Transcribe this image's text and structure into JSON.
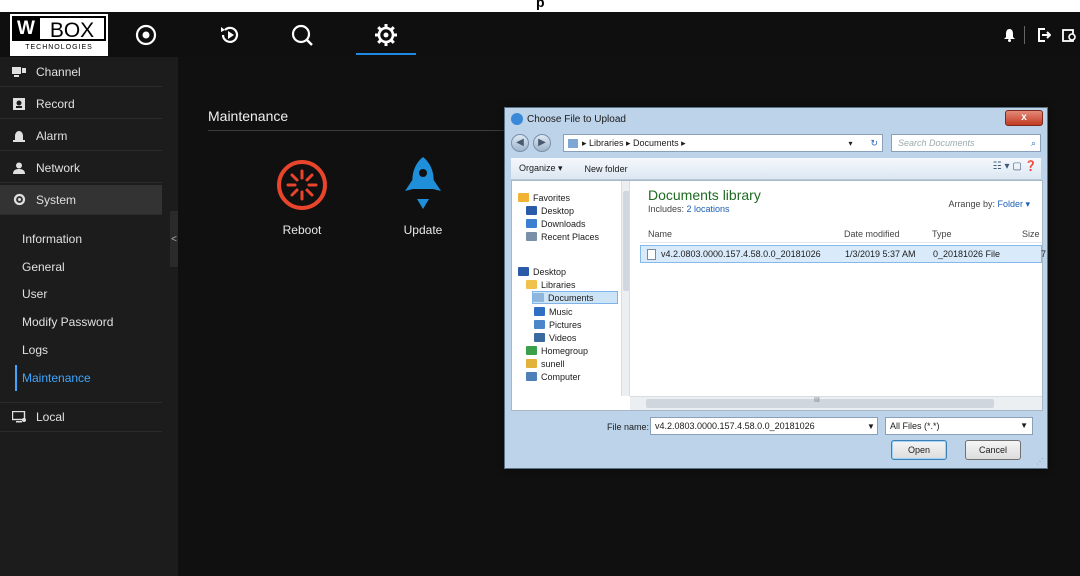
{
  "top_banner": "p",
  "brand": {
    "logo_main_left": "W",
    "logo_main_right": "BOX",
    "logo_sub": "TECHNOLOGIES"
  },
  "top_nav": [
    "live-view-icon",
    "playback-icon",
    "search-icon",
    "settings-icon"
  ],
  "top_right": [
    "bell-icon",
    "logout-icon",
    "lock-icon"
  ],
  "sidebar": {
    "items": [
      {
        "label": "Channel",
        "icon": "channel-icon"
      },
      {
        "label": "Record",
        "icon": "record-icon"
      },
      {
        "label": "Alarm",
        "icon": "alarm-icon"
      },
      {
        "label": "Network",
        "icon": "network-icon"
      },
      {
        "label": "System",
        "icon": "system-gear-icon"
      }
    ],
    "sub_items": [
      "Information",
      "General",
      "User",
      "Modify Password",
      "Logs",
      "Maintenance"
    ],
    "active_sub": "Maintenance",
    "local": {
      "label": "Local",
      "icon": "local-icon"
    },
    "collapse_glyph": "<"
  },
  "main": {
    "title": "Maintenance",
    "actions": [
      {
        "label": "Reboot",
        "icon": "reboot-icon",
        "color": "#e8452c"
      },
      {
        "label": "Update",
        "icon": "rocket-icon",
        "color": "#1e8fd8"
      }
    ]
  },
  "dialog": {
    "title": "Choose File to Upload",
    "close_label": "x",
    "back_glyph": "◀",
    "forward_glyph": "▶",
    "address": "▸ Libraries ▸ Documents ▸",
    "address_dropdown": "▾",
    "refresh_glyph": "↻",
    "search_placeholder": "Search Documents",
    "toolbar": {
      "organize": "Organize ▾",
      "new_folder": "New folder",
      "view_icons": "☷ ▾   ▢   ❓"
    },
    "nav_pane": [
      {
        "label": "Favorites",
        "icon": "star-icon",
        "color": "#f2b233",
        "indent": 0
      },
      {
        "label": "Desktop",
        "icon": "desktop-icon",
        "color": "#2a5aa8",
        "indent": 1
      },
      {
        "label": "Downloads",
        "icon": "downloads-icon",
        "color": "#3c7fd0",
        "indent": 1
      },
      {
        "label": "Recent Places",
        "icon": "recent-icon",
        "color": "#7a8fa8",
        "indent": 1
      },
      {
        "label": "Desktop",
        "icon": "desktop-icon",
        "color": "#2a5aa8",
        "indent": 0
      },
      {
        "label": "Libraries",
        "icon": "libraries-icon",
        "color": "#f0c24d",
        "indent": 1
      },
      {
        "label": "Documents",
        "icon": "documents-icon",
        "color": "#8fb6dc",
        "indent": 2,
        "selected": true
      },
      {
        "label": "Music",
        "icon": "music-icon",
        "color": "#2e6fc4",
        "indent": 2
      },
      {
        "label": "Pictures",
        "icon": "pictures-icon",
        "color": "#4a86c8",
        "indent": 2
      },
      {
        "label": "Videos",
        "icon": "videos-icon",
        "color": "#3a6b9e",
        "indent": 2
      },
      {
        "label": "Homegroup",
        "icon": "homegroup-icon",
        "color": "#3aa14a",
        "indent": 1
      },
      {
        "label": "sunell",
        "icon": "user-folder-icon",
        "color": "#e2b23a",
        "indent": 1
      },
      {
        "label": "Computer",
        "icon": "computer-icon",
        "color": "#4f7fb8",
        "indent": 1
      }
    ],
    "library_title": "Documents library",
    "includes_prefix": "Includes: ",
    "includes_link": "2 locations",
    "arrange_label": "Arrange by: ",
    "arrange_value": "Folder ▾",
    "columns": [
      "Name",
      "Date modified",
      "Type",
      "Size"
    ],
    "file": {
      "name": "v4.2.0803.0000.157.4.58.0.0_20181026",
      "date": "1/3/2019 5:37 AM",
      "type": "0_20181026 File",
      "size": "7"
    },
    "file_name_label": "File name:",
    "file_name_value": "v4.2.0803.0000.157.4.58.0.0_20181026",
    "file_type": "All Files (*.*)",
    "dropdown_glyph": "▼",
    "scroll_glyph": "III",
    "open_label": "Open",
    "cancel_label": "Cancel"
  }
}
